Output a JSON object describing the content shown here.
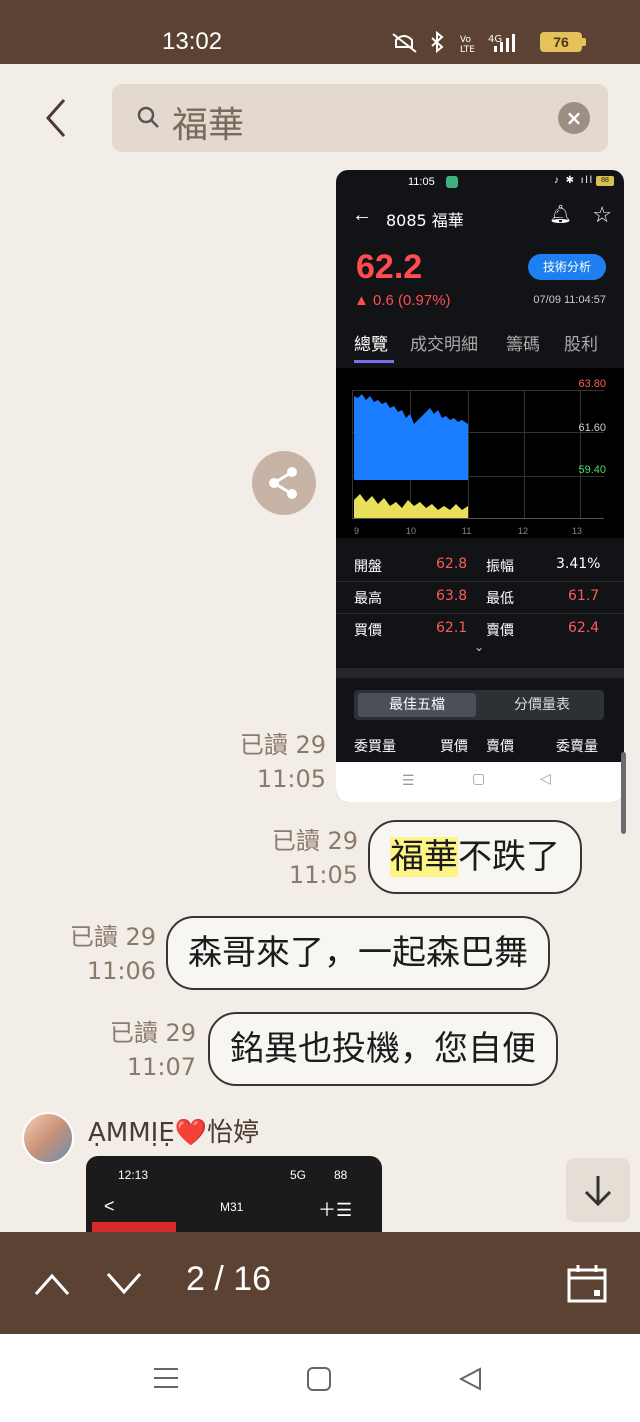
{
  "status_bar": {
    "time": "13:02",
    "icons": [
      "mute-icon",
      "bluetooth-icon",
      "volte-icon",
      "4g-signal-icon"
    ],
    "volte": "Vo LTE",
    "network": "4G",
    "battery": "76"
  },
  "search": {
    "query": "福華"
  },
  "stock_screenshot": {
    "status_time": "11:05",
    "status_battery": "88",
    "title": "8085 福華",
    "price": "62.2",
    "change": "▲ 0.6 (0.97%)",
    "tech_button": "技術分析",
    "datetime": "07/09 11:04:57",
    "tabs": [
      "總覽",
      "成交明細",
      "籌碼",
      "股利"
    ],
    "price_levels": [
      "63.80",
      "61.60",
      "59.40"
    ],
    "x_labels": [
      "9",
      "10",
      "11",
      "12",
      "13"
    ],
    "rows": [
      {
        "k1": "開盤",
        "v1": "62.8",
        "k2": "振幅",
        "v2": "3.41%"
      },
      {
        "k1": "最高",
        "v1": "63.8",
        "k2": "最低",
        "v2": "61.7"
      },
      {
        "k1": "買價",
        "v1": "62.1",
        "k2": "賣價",
        "v2": "62.4"
      }
    ],
    "seg_active": "最佳五檔",
    "seg_other": "分價量表",
    "columns": [
      "委買量",
      "買價",
      "賣價",
      "委賣量"
    ]
  },
  "messages": [
    {
      "read": "已讀 29",
      "time": "11:05"
    },
    {
      "read": "已讀 29",
      "time": "11:05",
      "highlight": "福華",
      "text_rest": "不跌了"
    },
    {
      "read": "已讀 29",
      "time": "11:06",
      "text": "森哥來了，一起森巴舞"
    },
    {
      "read": "已讀 29",
      "time": "11:07",
      "text": "銘異也投機，您自便"
    }
  ],
  "sender": {
    "name": "ẠMMỊẸ❤️怡婷"
  },
  "preview": {
    "time": "12:13",
    "title": "M31",
    "signal": "5G",
    "battery": "88"
  },
  "bottom_bar": {
    "counter": "2 / 16"
  }
}
